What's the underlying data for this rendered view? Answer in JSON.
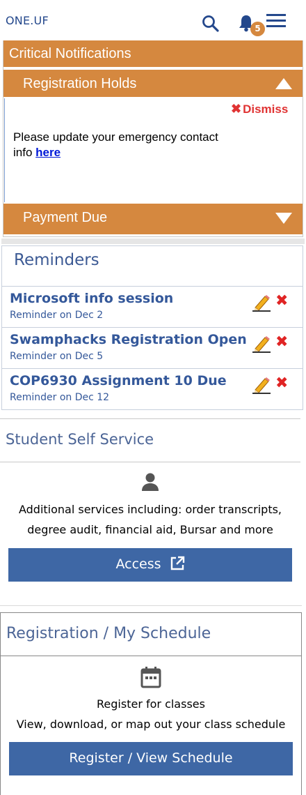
{
  "header": {
    "brand": "ONE.UF",
    "notification_count": "5"
  },
  "critical": {
    "title": "Critical Notifications",
    "registration_holds": {
      "label": "Registration Holds",
      "dismiss": "Dismiss",
      "message_prefix": "Please update your emergency contact info ",
      "link_text": "here"
    },
    "payment_due": {
      "label": "Payment Due"
    }
  },
  "reminders": {
    "title": "Reminders",
    "items": [
      {
        "name": "Microsoft info session",
        "date": "Reminder on Dec 2"
      },
      {
        "name": "Swamphacks Registration Open",
        "date": "Reminder on Dec 5"
      },
      {
        "name": "COP6930 Assignment 10 Due",
        "date": "Reminder on Dec 12"
      }
    ]
  },
  "self_service": {
    "title": "Student Self Service",
    "description_line1": "Additional services including: order transcripts,",
    "description_line2": "degree audit, financial aid, Bursar and more",
    "button": "Access"
  },
  "registration": {
    "title": "Registration / My Schedule",
    "line1": "Register for classes",
    "line2": "View, download, or map out your class schedule",
    "button": "Register / View Schedule"
  },
  "colors": {
    "accent_orange": "#d5883f",
    "brand_blue": "#3e67a5",
    "danger_red": "#e02424"
  },
  "icons": [
    "search-icon",
    "bell-icon",
    "menu-icon",
    "caret-up-icon",
    "caret-down-icon",
    "close-icon",
    "pencil-icon",
    "person-icon",
    "external-link-icon",
    "calendar-icon"
  ]
}
